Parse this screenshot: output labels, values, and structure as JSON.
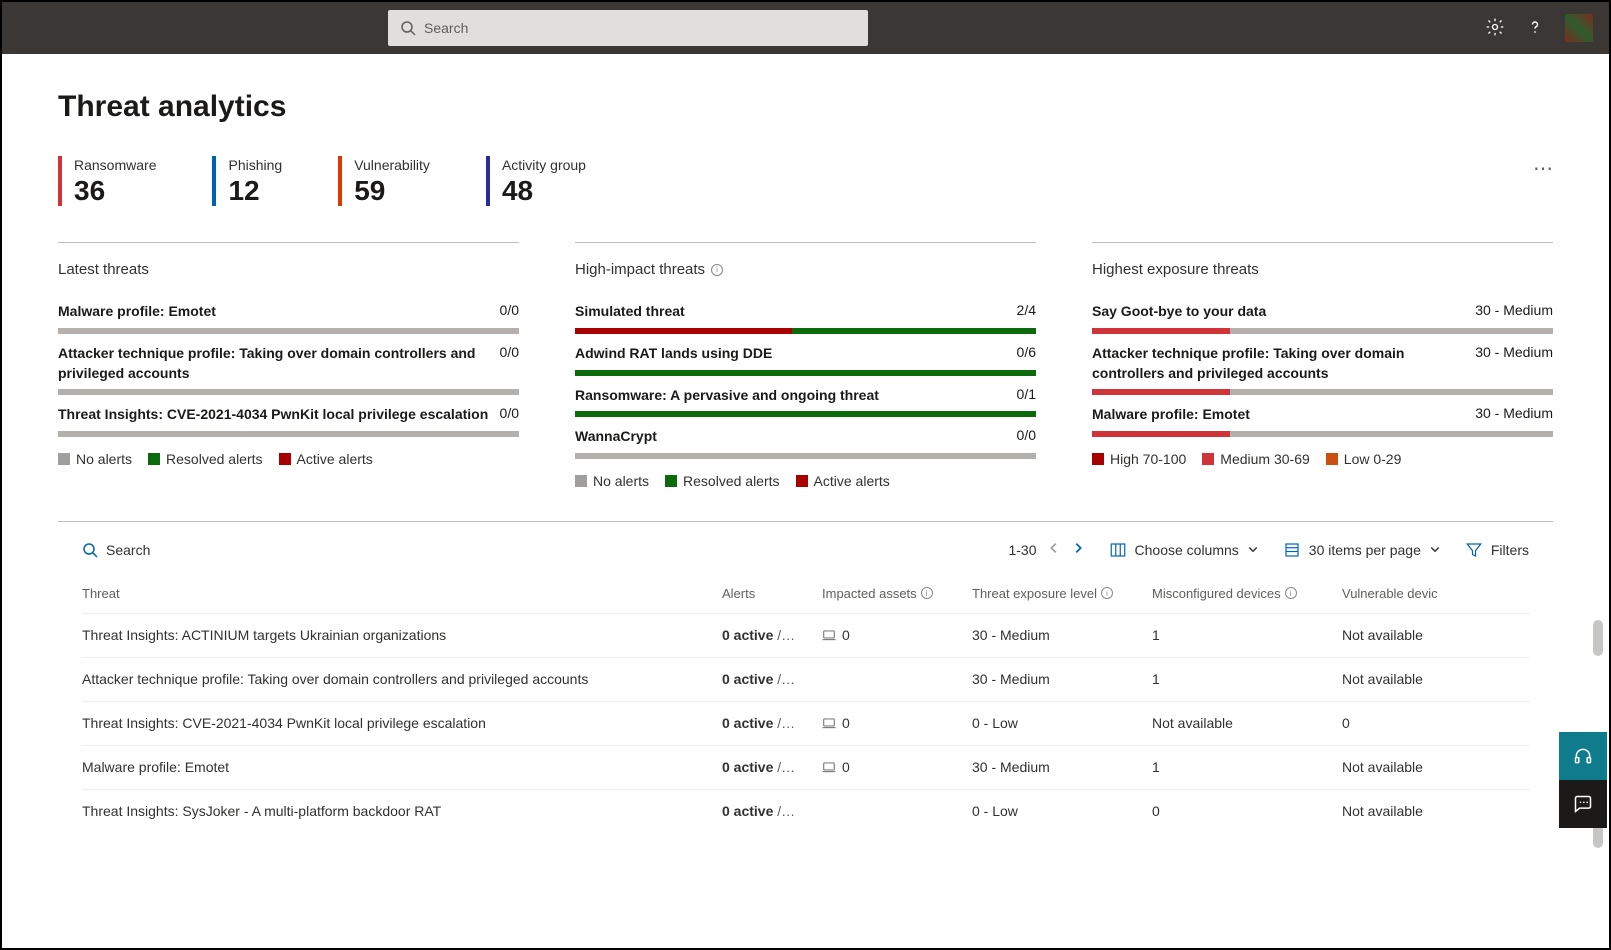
{
  "header": {
    "search_placeholder": "Search"
  },
  "page_title": "Threat analytics",
  "more_label": "⋯",
  "stats": [
    {
      "label": "Ransomware",
      "value": "36",
      "color": "#d13438"
    },
    {
      "label": "Phishing",
      "value": "12",
      "color": "#0063b1"
    },
    {
      "label": "Vulnerability",
      "value": "59",
      "color": "#d83b01"
    },
    {
      "label": "Activity group",
      "value": "48",
      "color": "#2b2b99"
    }
  ],
  "panels": {
    "latest": {
      "title": "Latest threats",
      "items": [
        {
          "name": "Malware profile: Emotet",
          "value": "0/0",
          "bar": []
        },
        {
          "name": "Attacker technique profile: Taking over domain controllers and privileged accounts",
          "value": "0/0",
          "bar": []
        },
        {
          "name": "Threat Insights: CVE-2021-4034 PwnKit local privilege escalation",
          "value": "0/0",
          "bar": []
        }
      ],
      "legend": [
        {
          "color": "gray",
          "label": "No alerts"
        },
        {
          "color": "green",
          "label": "Resolved alerts"
        },
        {
          "color": "red",
          "label": "Active alerts"
        }
      ]
    },
    "high_impact": {
      "title": "High-impact threats",
      "items": [
        {
          "name": "Simulated threat",
          "value": "2/4",
          "bar": [
            {
              "cls": "red",
              "pct": 47
            },
            {
              "cls": "green",
              "pct": 53
            }
          ]
        },
        {
          "name": "Adwind RAT lands using DDE",
          "value": "0/6",
          "bar": [
            {
              "cls": "green",
              "pct": 100
            }
          ]
        },
        {
          "name": "Ransomware: A pervasive and ongoing threat",
          "value": "0/1",
          "bar": [
            {
              "cls": "green",
              "pct": 100
            }
          ]
        },
        {
          "name": "WannaCrypt",
          "value": "0/0",
          "bar": []
        }
      ],
      "legend": [
        {
          "color": "gray",
          "label": "No alerts"
        },
        {
          "color": "green",
          "label": "Resolved alerts"
        },
        {
          "color": "red",
          "label": "Active alerts"
        }
      ]
    },
    "exposure": {
      "title": "Highest exposure threats",
      "items": [
        {
          "name": "Say Goot-bye to your data",
          "value": "30 - Medium",
          "bar": [
            {
              "cls": "medium",
              "pct": 30
            }
          ]
        },
        {
          "name": "Attacker technique profile: Taking over domain controllers and privileged accounts",
          "value": "30 - Medium",
          "bar": [
            {
              "cls": "medium",
              "pct": 30
            }
          ]
        },
        {
          "name": "Malware profile: Emotet",
          "value": "30 - Medium",
          "bar": [
            {
              "cls": "medium",
              "pct": 30
            }
          ]
        }
      ],
      "legend": [
        {
          "color": "red",
          "label": "High 70-100"
        },
        {
          "color": "medred",
          "label": "Medium 30-69"
        },
        {
          "color": "orange",
          "label": "Low 0-29"
        }
      ]
    }
  },
  "table": {
    "search_label": "Search",
    "pager_label": "1-30",
    "choose_cols": "Choose columns",
    "page_size": "30 items per page",
    "filters": "Filters",
    "columns": [
      "Threat",
      "Alerts",
      "Impacted assets",
      "Threat exposure level",
      "Misconfigured devices",
      "Vulnerable devic"
    ],
    "col_has_info": [
      false,
      false,
      true,
      true,
      true,
      false
    ],
    "rows": [
      {
        "threat": "Threat Insights: ACTINIUM targets Ukrainian organizations",
        "alerts_active": "0 active",
        "alerts_rest": " /…",
        "assets": "0",
        "exposure": "30 - Medium",
        "misconf": "1",
        "vuln": "Not available"
      },
      {
        "threat": "Attacker technique profile: Taking over domain controllers and privileged accounts",
        "alerts_active": "0 active",
        "alerts_rest": " /…",
        "assets": "",
        "exposure": "30 - Medium",
        "misconf": "1",
        "vuln": "Not available"
      },
      {
        "threat": "Threat Insights: CVE-2021-4034 PwnKit local privilege escalation",
        "alerts_active": "0 active",
        "alerts_rest": " /…",
        "assets": "0",
        "exposure": "0 - Low",
        "misconf": "Not available",
        "vuln": "0"
      },
      {
        "threat": "Malware profile: Emotet",
        "alerts_active": "0 active",
        "alerts_rest": " /…",
        "assets": "0",
        "exposure": "30 - Medium",
        "misconf": "1",
        "vuln": "Not available"
      },
      {
        "threat": "Threat Insights: SysJoker - A multi-platform backdoor RAT",
        "alerts_active": "0 active",
        "alerts_rest": " /…",
        "assets": "",
        "exposure": "0 - Low",
        "misconf": "0",
        "vuln": "Not available"
      }
    ]
  }
}
